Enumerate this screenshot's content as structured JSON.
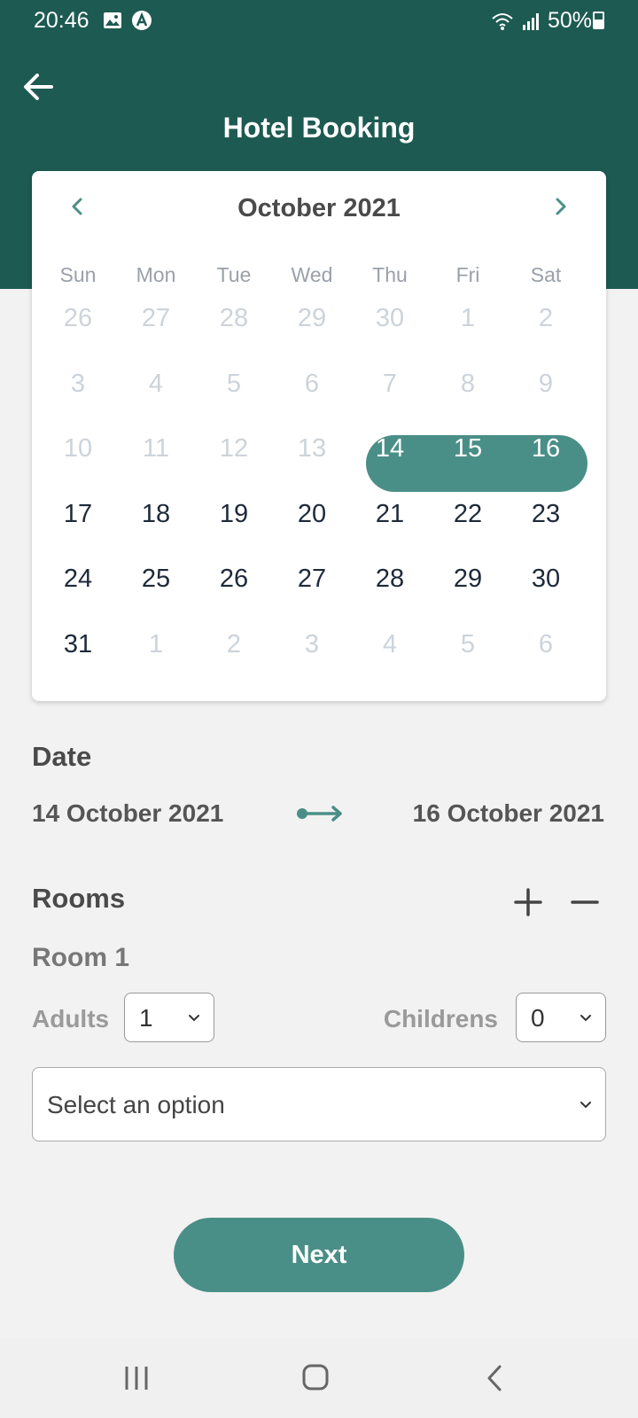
{
  "status_bar": {
    "time": "20:46",
    "battery": "50%"
  },
  "header": {
    "title": "Hotel Booking"
  },
  "calendar": {
    "month_label": "October 2021",
    "weekdays": [
      "Sun",
      "Mon",
      "Tue",
      "Wed",
      "Thu",
      "Fri",
      "Sat"
    ],
    "weeks": [
      [
        "26",
        "27",
        "28",
        "29",
        "30",
        "1",
        "2"
      ],
      [
        "3",
        "4",
        "5",
        "6",
        "7",
        "8",
        "9"
      ],
      [
        "10",
        "11",
        "12",
        "13",
        "14",
        "15",
        "16"
      ],
      [
        "17",
        "18",
        "19",
        "20",
        "21",
        "22",
        "23"
      ],
      [
        "24",
        "25",
        "26",
        "27",
        "28",
        "29",
        "30"
      ],
      [
        "31",
        "1",
        "2",
        "3",
        "4",
        "5",
        "6"
      ]
    ],
    "selected_range": [
      "14",
      "16"
    ]
  },
  "date_section": {
    "title": "Date",
    "from": "14 October 2021",
    "to": "16 October 2021"
  },
  "rooms_section": {
    "title": "Rooms",
    "room_label": "Room 1",
    "adults_label": "Adults",
    "adults_value": "1",
    "children_label": "Childrens",
    "children_value": "0",
    "option_placeholder": "Select an option"
  },
  "next_label": "Next",
  "colors": {
    "header": "#1d5a52",
    "accent": "#4a8f87",
    "background": "#f2f2f2"
  }
}
